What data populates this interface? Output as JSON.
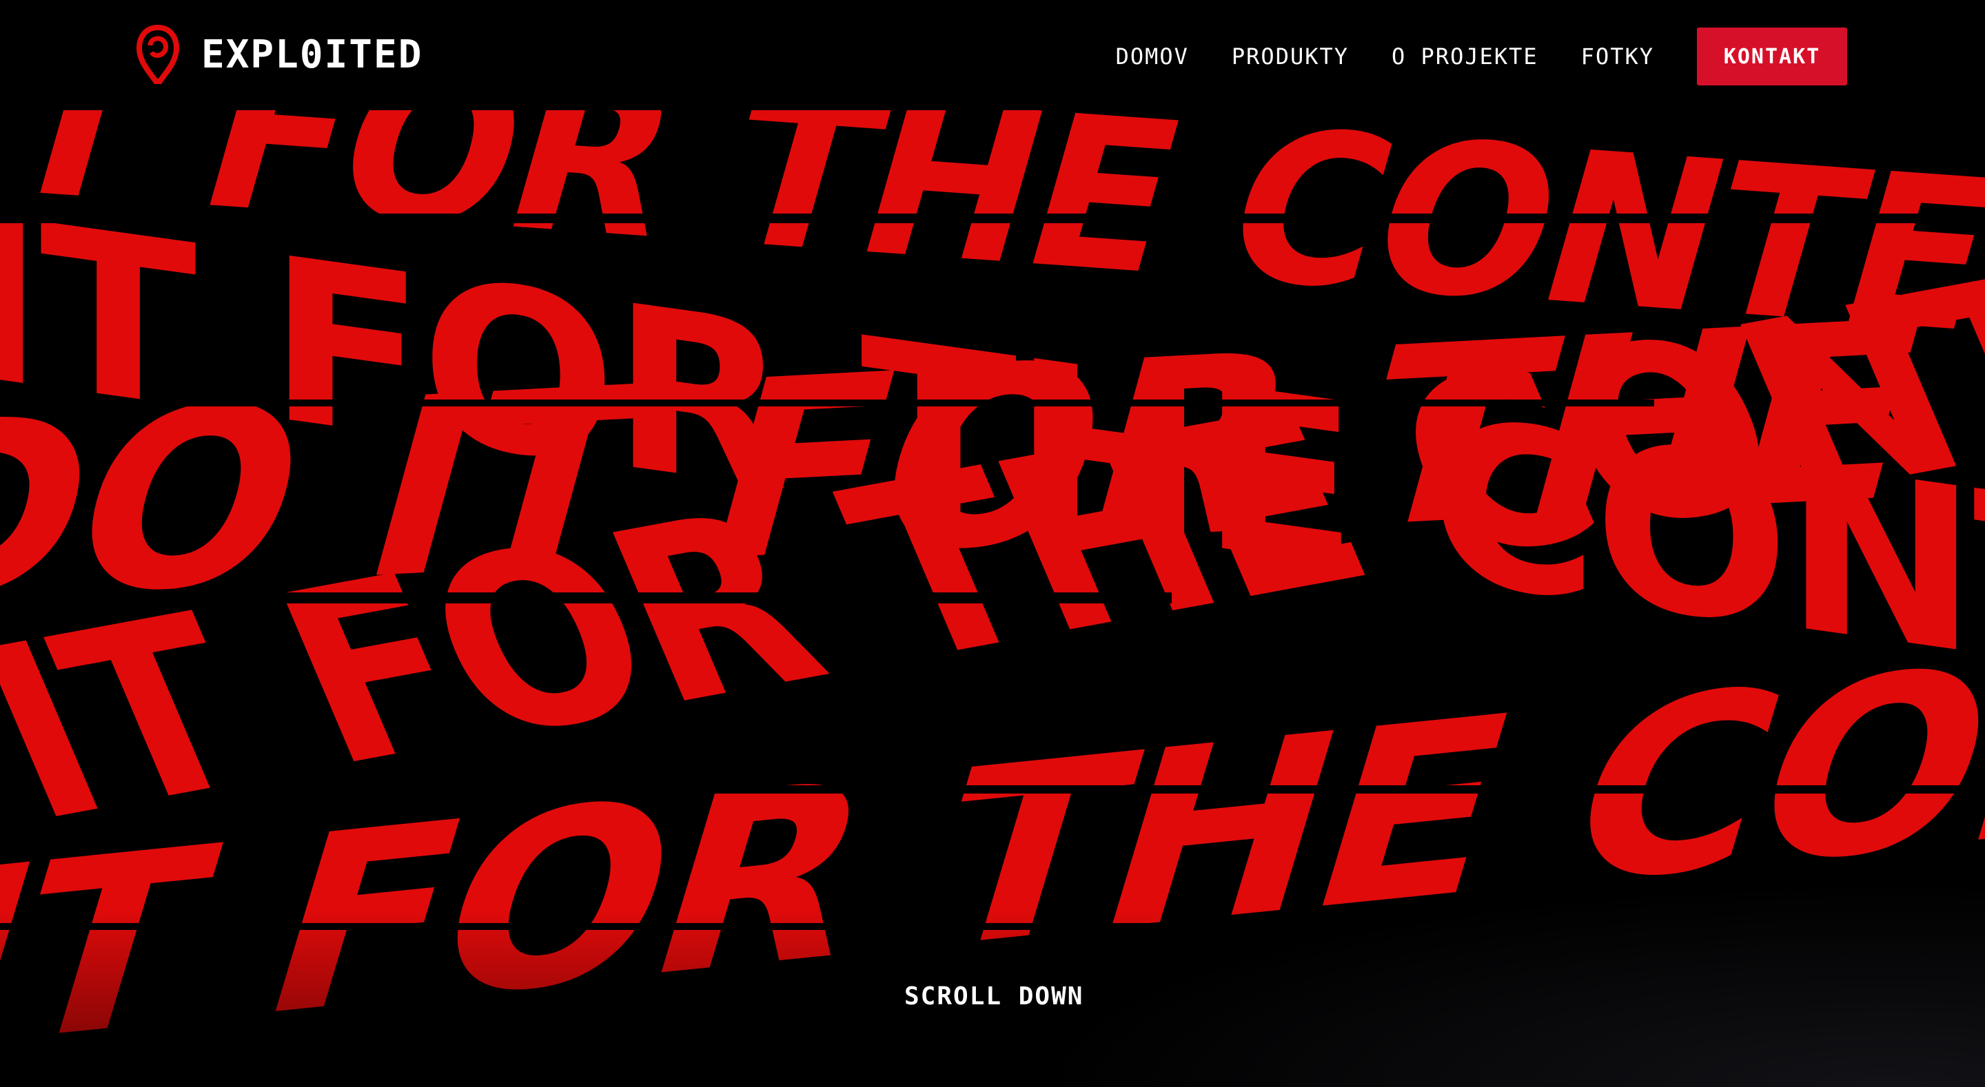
{
  "brand": {
    "name": "EXPL0ITED",
    "logo_icon": "pin-logo-icon",
    "accent": "#e10a0a",
    "cta_color": "#d7102a"
  },
  "nav": {
    "items": [
      {
        "label": "DOMOV"
      },
      {
        "label": "PRODUKTY"
      },
      {
        "label": "O PROJEKTE"
      },
      {
        "label": "FOTKY"
      }
    ],
    "cta": "KONTAKT"
  },
  "hero": {
    "lines": [
      "IT FOR THE CONTENT",
      "IT FOR THE CONTENT",
      "DO IT FOR THE CONTENT",
      "IT FOR THE CONTENT",
      "IT FOR THE CONTENT"
    ]
  },
  "scroll_label": "SCROLL DOWN"
}
